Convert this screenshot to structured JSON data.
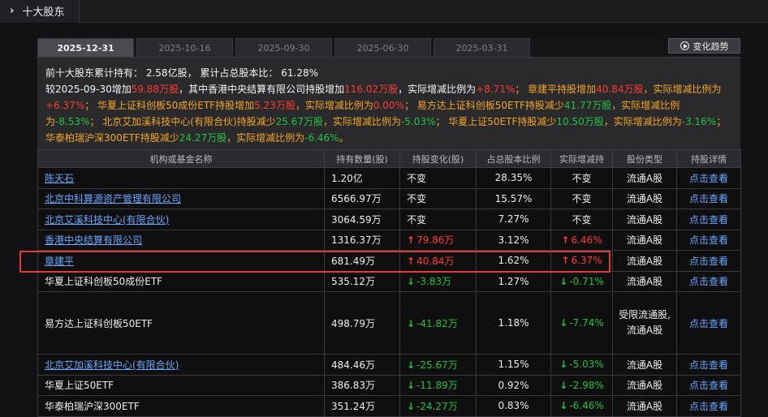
{
  "header": {
    "title": "十大股东"
  },
  "tabs": [
    "2025-12-31",
    "2025-10-16",
    "2025-09-30",
    "2025-06-30",
    "2025-03-31"
  ],
  "trend_button": "变化趋势",
  "summary": {
    "p1_label": "前十大股东累计持有：",
    "p1_value": "2.58亿股，",
    "p1_label2": "累计占总股本比：",
    "p1_value2": "61.28%",
    "s1": "较2025-09-30增加",
    "s2": "59.88万股",
    "s3": "，其中香港中央结算有限公司持股增加",
    "s4": "116.02万股",
    "s5": "，实际增减比例为",
    "s6": "+8.71%",
    "s7": "； 章建平持股增加",
    "s8": "40.84万股",
    "s9": "，",
    "s10": "实际增减比例为",
    "s11": "+6.37%",
    "s12": "； 华夏上证科创板50成份ETF持股增加",
    "s13": "5.23万股",
    "s14": "，实际增减比例为",
    "s15": "0.00%",
    "s16": "； 易方达上证科创板50ETF持股减少",
    "s17": "41.77",
    "s18": "万股",
    "s19": "，实际增减比例为",
    "s20": "-8.53%",
    "s21": "； 北京艾加溪科技中心(有限合伙)持股减少",
    "s22": "25.67万股",
    "s23": "，实际增减比例为",
    "s24": "-5.03%",
    "s25": "； 华夏上证50ETF持股减少",
    "s26": "10.50万股",
    "s27": "，实际增减比例为",
    "s28": "-3.16%",
    "s29": "； 华泰柏瑞沪深300ETF持股减少",
    "s30": "24.27万股",
    "s31": "，实际增减比例为",
    "s32": "-6.46%",
    "s33": "。"
  },
  "table": {
    "headers": [
      "机构或基金名称",
      "持有数量(股)",
      "持股变化(股)",
      "占总股本比例",
      "实际增减持",
      "股份类型",
      "持股详情"
    ],
    "rows": [
      {
        "name": "陈天石",
        "qty": "1.20亿",
        "chg": "不变",
        "ratio": "28.35%",
        "real": "不变",
        "type": "流通A股",
        "detail": "点击查看"
      },
      {
        "name": "北京中科算源资产管理有限公司",
        "qty": "6566.97万",
        "chg": "不变",
        "ratio": "15.57%",
        "real": "不变",
        "type": "流通A股",
        "detail": "点击查看"
      },
      {
        "name": "北京艾溪科技中心(有限合伙)",
        "qty": "3064.59万",
        "chg": "不变",
        "ratio": "7.27%",
        "real": "不变",
        "type": "流通A股",
        "detail": "点击查看"
      },
      {
        "name": "香港中央结算有限公司",
        "qty": "1316.37万",
        "chg": "79.86万",
        "ratio": "3.12%",
        "real": "6.46%",
        "type": "流通A股",
        "detail": "点击查看"
      },
      {
        "name": "章建平",
        "qty": "681.49万",
        "chg": "40.84万",
        "ratio": "1.62%",
        "real": "6.37%",
        "type": "流通A股",
        "detail": "点击查看"
      },
      {
        "name": "华夏上证科创板50成份ETF",
        "qty": "535.12万",
        "chg": "-3.83万",
        "ratio": "1.27%",
        "real": "-0.71%",
        "type": "流通A股",
        "detail": "点击查看"
      },
      {
        "name": "易方达上证科创板50ETF",
        "qty": "498.79万",
        "chg": "-41.82万",
        "ratio": "1.18%",
        "real": "-7.74%",
        "type": "受限流通股,流通A股",
        "detail": "点击查看"
      },
      {
        "name": "北京艾加溪科技中心(有限合伙)",
        "qty": "484.46万",
        "chg": "-25.67万",
        "ratio": "1.15%",
        "real": "-5.03%",
        "type": "流通A股",
        "detail": "点击查看"
      },
      {
        "name": "华夏上证50ETF",
        "qty": "386.83万",
        "chg": "-11.89万",
        "ratio": "0.92%",
        "real": "-2.98%",
        "type": "流通A股",
        "detail": "点击查看"
      },
      {
        "name": "华泰柏瑞沪深300ETF",
        "qty": "351.24万",
        "chg": "-24.27万",
        "ratio": "0.83%",
        "real": "-6.46%",
        "type": "流通A股",
        "detail": "点击查看"
      }
    ]
  },
  "colors": {
    "up": "#ff3b30",
    "down": "#1ec43b",
    "link": "#6aa7ff",
    "highlight": "#e23a3a"
  }
}
